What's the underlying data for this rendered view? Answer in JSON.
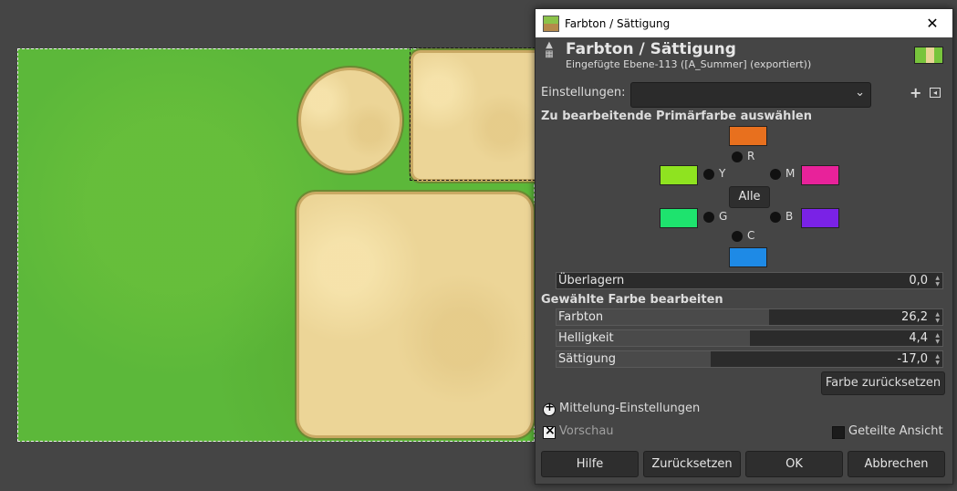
{
  "dialog": {
    "window_title": "Farbton / Sättigung",
    "close_icon": "close-icon",
    "header_title": "Farbton / Sättigung",
    "header_subtitle": "Eingefügte Ebene-113 ([A_Summer] (exportiert))",
    "presets_label": "Einstellungen:",
    "presets_value": "",
    "primary_section": "Zu bearbeitende Primärfarbe auswählen",
    "colors": {
      "r": {
        "label": "R",
        "color": "#e8701e"
      },
      "y": {
        "label": "Y",
        "color": "#8fe320"
      },
      "m": {
        "label": "M",
        "color": "#e8229a"
      },
      "g": {
        "label": "G",
        "color": "#1ee36e"
      },
      "b": {
        "label": "B",
        "color": "#7a22e6"
      },
      "c": {
        "label": "C",
        "color": "#1e8ae6"
      }
    },
    "all_button": "Alle",
    "overlap": {
      "label": "Überlagern",
      "value": "0,0",
      "fraction": 0.0
    },
    "edit_section": "Gewählte Farbe bearbeiten",
    "hue": {
      "label": "Farbton",
      "value": "26,2",
      "fraction": 0.55
    },
    "lightness": {
      "label": "Helligkeit",
      "value": "4,4",
      "fraction": 0.5
    },
    "saturation": {
      "label": "Sättigung",
      "value": "-17,0",
      "fraction": 0.4
    },
    "reset_color": "Farbe zurücksetzen",
    "averaging_label": "Mittelung-Einstellungen",
    "preview_label": "Vorschau",
    "split_label": "Geteilte Ansicht",
    "buttons": {
      "help": "Hilfe",
      "reset": "Zurücksetzen",
      "ok": "OK",
      "cancel": "Abbrechen"
    }
  }
}
